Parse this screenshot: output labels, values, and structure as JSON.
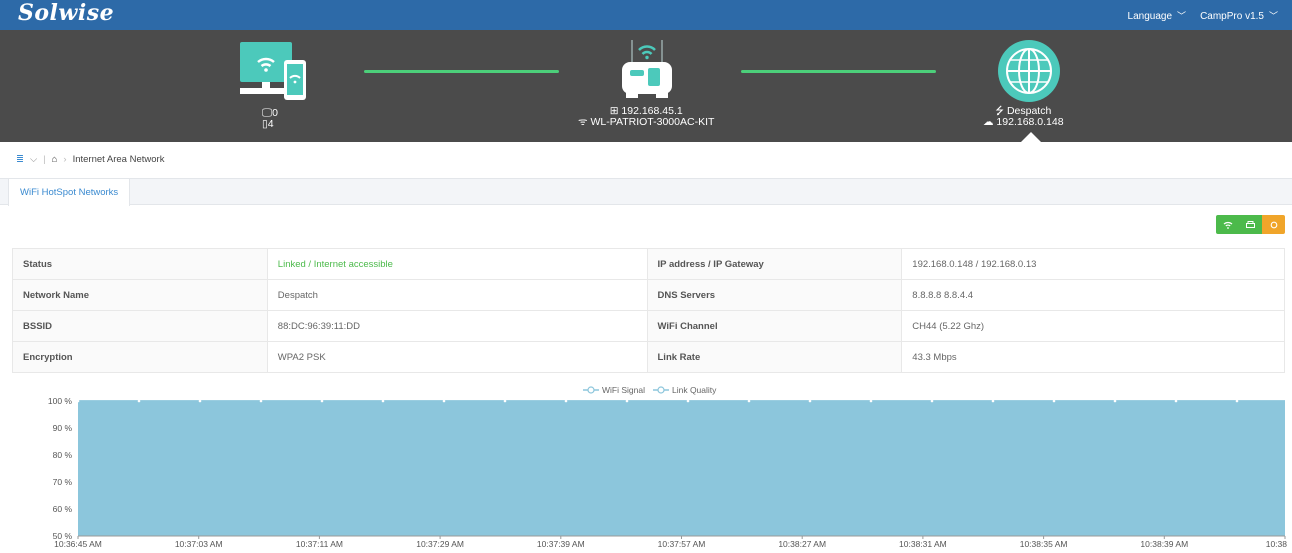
{
  "header": {
    "logo": "Solwise",
    "language_label": "Language",
    "version_label": "CampPro v1.5"
  },
  "network": {
    "clients": {
      "wired": "0",
      "wireless": "4"
    },
    "router": {
      "ip": "192.168.45.1",
      "ssid": "WL-PATRIOT-3000AC-KIT"
    },
    "internet": {
      "network": "Despatch",
      "ip": "192.168.0.148"
    },
    "colors": {
      "link": "#4ccf7a",
      "icon": "#4cc9bb"
    }
  },
  "breadcrumb": {
    "page": "Internet Area Network"
  },
  "tabs": [
    {
      "label": "WiFi HotSpot Networks"
    }
  ],
  "info": {
    "status": {
      "label": "Status",
      "value": "Linked / Internet accessible"
    },
    "ip": {
      "label": "IP address / IP Gateway",
      "value": "192.168.0.148 / 192.168.0.13"
    },
    "name": {
      "label": "Network Name",
      "value": "Despatch"
    },
    "dns": {
      "label": "DNS Servers",
      "value": "8.8.8.8 8.8.4.4"
    },
    "bssid": {
      "label": "BSSID",
      "value": "88:DC:96:39:11:DD"
    },
    "channel": {
      "label": "WiFi Channel",
      "value": "CH44 (5.22 Ghz)"
    },
    "encryption": {
      "label": "Encryption",
      "value": "WPA2 PSK"
    },
    "rate": {
      "label": "Link Rate",
      "value": "43.3 Mbps"
    }
  },
  "chart_data": {
    "type": "area",
    "series": [
      {
        "name": "WiFi Signal",
        "values": [
          100,
          100,
          100,
          100,
          100,
          100,
          100,
          100,
          100,
          100,
          100
        ]
      },
      {
        "name": "Link Quality",
        "values": [
          100,
          100,
          100,
          100,
          100,
          100,
          100,
          100,
          100,
          100,
          100
        ]
      }
    ],
    "categories": [
      "10:36:45 AM",
      "10:37:03 AM",
      "10:37:11 AM",
      "10:37:29 AM",
      "10:37:39 AM",
      "10:37:57 AM",
      "10:38:27 AM",
      "10:38:31 AM",
      "10:38:35 AM",
      "10:38:39 AM",
      "10:38"
    ],
    "yticks": [
      "100 %",
      "90 %",
      "80 %",
      "70 %",
      "60 %",
      "50 %"
    ],
    "ylim": [
      50,
      100
    ],
    "fill": "#8cc6dc",
    "grid": true,
    "legend": "top-center"
  }
}
